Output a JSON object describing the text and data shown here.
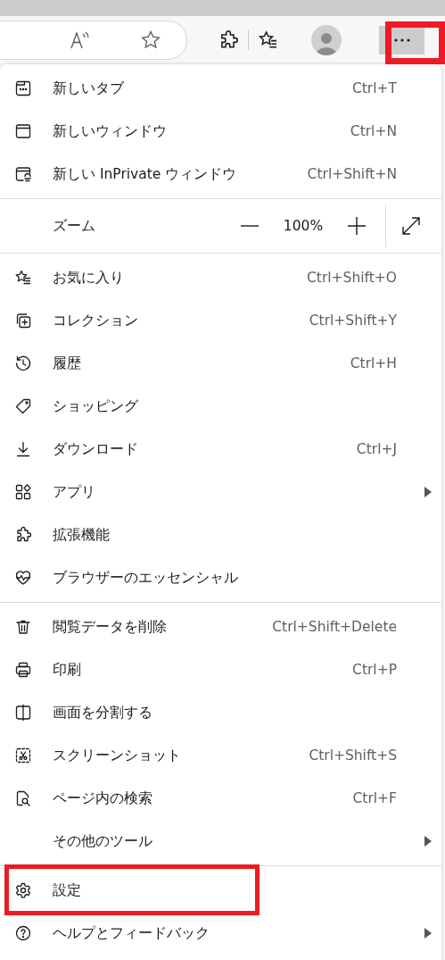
{
  "toolbar": {
    "more_button": {
      "highlighted": true
    }
  },
  "menu": {
    "sections": [
      {
        "items": [
          {
            "kind": "command",
            "label": "新しいタブ",
            "shortcut": "Ctrl+T",
            "submenu": false,
            "highlighted": false
          },
          {
            "kind": "command",
            "label": "新しいウィンドウ",
            "shortcut": "Ctrl+N",
            "submenu": false,
            "highlighted": false
          },
          {
            "kind": "command",
            "label": "新しい InPrivate ウィンドウ",
            "shortcut": "Ctrl+Shift+N",
            "submenu": false,
            "highlighted": false
          }
        ]
      },
      {
        "items": [
          {
            "kind": "zoom",
            "label": "ズーム",
            "value": "100%"
          }
        ]
      },
      {
        "items": [
          {
            "kind": "command",
            "label": "お気に入り",
            "shortcut": "Ctrl+Shift+O",
            "submenu": false,
            "highlighted": false
          },
          {
            "kind": "command",
            "label": "コレクション",
            "shortcut": "Ctrl+Shift+Y",
            "submenu": false,
            "highlighted": false
          },
          {
            "kind": "command",
            "label": "履歴",
            "shortcut": "Ctrl+H",
            "submenu": false,
            "highlighted": false
          },
          {
            "kind": "command",
            "label": "ショッピング",
            "submenu": false,
            "highlighted": false
          },
          {
            "kind": "command",
            "label": "ダウンロード",
            "shortcut": "Ctrl+J",
            "submenu": false,
            "highlighted": false
          },
          {
            "kind": "command",
            "label": "アプリ",
            "submenu": true,
            "highlighted": false
          },
          {
            "kind": "command",
            "label": "拡張機能",
            "submenu": false,
            "highlighted": false
          },
          {
            "kind": "command",
            "label": "ブラウザーのエッセンシャル",
            "submenu": false,
            "highlighted": false
          }
        ]
      },
      {
        "items": [
          {
            "kind": "command",
            "label": "閲覧データを削除",
            "shortcut": "Ctrl+Shift+Delete",
            "submenu": false,
            "highlighted": false
          },
          {
            "kind": "command",
            "label": "印刷",
            "shortcut": "Ctrl+P",
            "submenu": false,
            "highlighted": false
          },
          {
            "kind": "command",
            "label": "画面を分割する",
            "submenu": false,
            "highlighted": false
          },
          {
            "kind": "command",
            "label": "スクリーンショット",
            "shortcut": "Ctrl+Shift+S",
            "submenu": false,
            "highlighted": false
          },
          {
            "kind": "command",
            "label": "ページ内の検索",
            "shortcut": "Ctrl+F",
            "submenu": false,
            "highlighted": false
          },
          {
            "kind": "command",
            "label": "その他のツール",
            "submenu": true,
            "highlighted": false
          }
        ]
      },
      {
        "items": [
          {
            "kind": "command",
            "label": "設定",
            "submenu": false,
            "highlighted": true
          },
          {
            "kind": "command",
            "label": "ヘルプとフィードバック",
            "submenu": true,
            "highlighted": false
          }
        ]
      }
    ]
  }
}
